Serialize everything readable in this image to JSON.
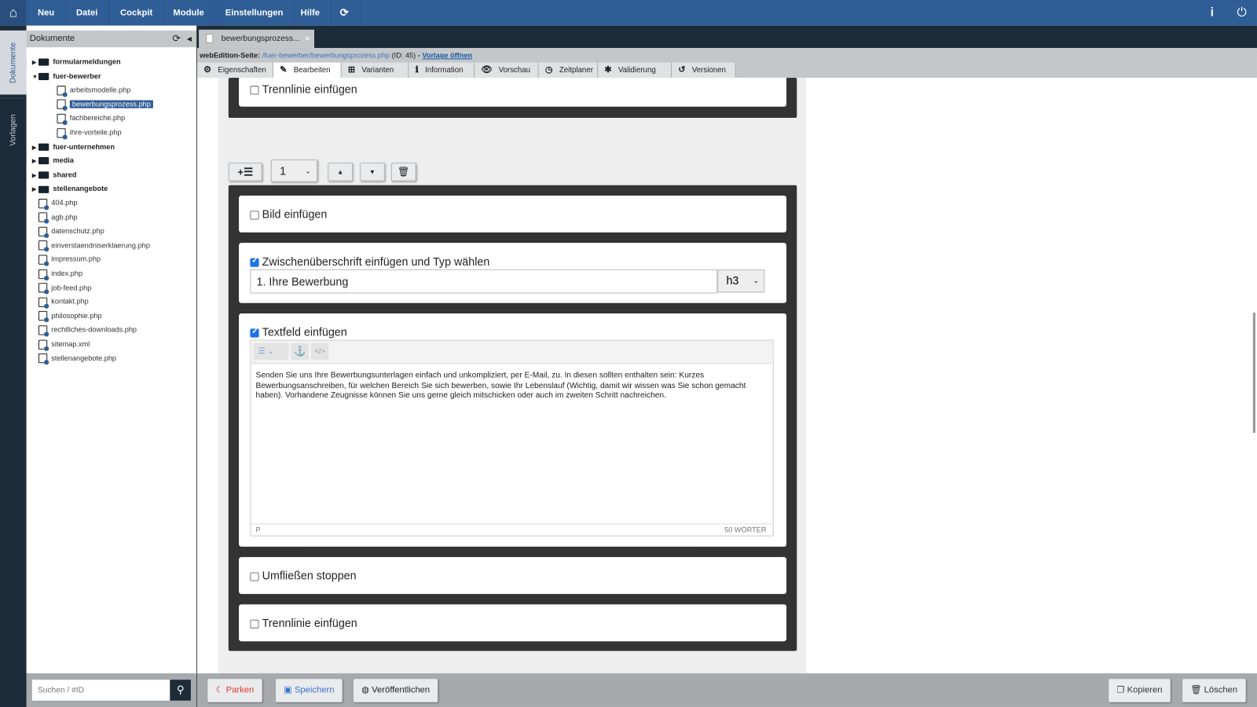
{
  "topbar": {
    "menu": [
      "Neu",
      "Datei",
      "Cockpit",
      "Module",
      "Einstellungen",
      "Hilfe"
    ],
    "icons": [
      "home-icon",
      "refresh-icon",
      "info-icon",
      "power-icon"
    ]
  },
  "vtabs": {
    "documents": "Dokumente",
    "templates": "Vorlagen"
  },
  "sidebar": {
    "title": "Dokumente",
    "tree": [
      {
        "label": "formularmeldungen",
        "type": "folder",
        "level": 0
      },
      {
        "label": "fuer-bewerber",
        "type": "folder-open",
        "level": 0
      },
      {
        "label": "arbeitsmodelle.php",
        "type": "file",
        "level": 1
      },
      {
        "label": "bewerbungsprozess.php",
        "type": "file",
        "level": 1,
        "selected": true
      },
      {
        "label": "fachbereiche.php",
        "type": "file",
        "level": 1
      },
      {
        "label": "ihre-vorteile.php",
        "type": "file",
        "level": 1
      },
      {
        "label": "fuer-unternehmen",
        "type": "folder",
        "level": 0
      },
      {
        "label": "media",
        "type": "folder",
        "level": 0
      },
      {
        "label": "shared",
        "type": "folder",
        "level": 0
      },
      {
        "label": "stellenangebote",
        "type": "folder",
        "level": 0
      },
      {
        "label": "404.php",
        "type": "file",
        "level": 0
      },
      {
        "label": "agb.php",
        "type": "file",
        "level": 0
      },
      {
        "label": "datenschutz.php",
        "type": "file",
        "level": 0
      },
      {
        "label": "einverstaendniserklaerung.php",
        "type": "file",
        "level": 0
      },
      {
        "label": "impressum.php",
        "type": "file",
        "level": 0
      },
      {
        "label": "index.php",
        "type": "file",
        "level": 0
      },
      {
        "label": "job-feed.php",
        "type": "file",
        "level": 0
      },
      {
        "label": "kontakt.php",
        "type": "file",
        "level": 0
      },
      {
        "label": "philosophie.php",
        "type": "file",
        "level": 0
      },
      {
        "label": "rechtliches-downloads.php",
        "type": "file",
        "level": 0
      },
      {
        "label": "sitemap.xml",
        "type": "file",
        "level": 0
      },
      {
        "label": "stellenangebote.php",
        "type": "file",
        "level": 0
      }
    ],
    "search_placeholder": "Suchen / #ID"
  },
  "doc_tab": {
    "label": "bewerbungsprozess...",
    "close": "×"
  },
  "pathbar": {
    "prefix": "webEdition-Seite:",
    "path": "/fuer-bewerber/bewerbungsprozess.php",
    "id": "(ID: 45)",
    "sep": "-",
    "link": "Vorlage öffnen"
  },
  "subtabs": [
    {
      "label": "Eigenschaften",
      "icon": "⚙"
    },
    {
      "label": "Bearbeiten",
      "icon": "✎",
      "active": true
    },
    {
      "label": "Varianten",
      "icon": "⊞"
    },
    {
      "label": "Information",
      "icon": "ℹ"
    },
    {
      "label": "Vorschau",
      "icon": "👁"
    },
    {
      "label": "Zeitplaner",
      "icon": "◷"
    },
    {
      "label": "Validierung",
      "icon": "✱"
    },
    {
      "label": "Versionen",
      "icon": "↺"
    }
  ],
  "editor": {
    "top_divider": "Trennlinie einfügen",
    "block_select": "1",
    "image": {
      "label": "Bild einfügen",
      "checked": false
    },
    "heading": {
      "label": "Zwischenüberschrift einfügen und Typ wählen",
      "checked": true,
      "value": "1. Ihre Bewerbung",
      "type": "h3"
    },
    "text": {
      "label": "Textfeld einfügen",
      "checked": true,
      "body": "Senden Sie uns Ihre Bewerbungsunterlagen einfach und unkompliziert, per E-Mail, zu. In diesen sollten enthalten sein: Kurzes Bewerbungsanschreiben, für welchen Bereich Sie sich bewerben, sowie Ihr Lebenslauf (Wichtig, damit wir wissen was Sie schon gemacht haben). Vorhandene Zeugnisse können Sie uns gerne gleich mitschicken oder auch im zweiten Schritt nachreichen.",
      "path": "P",
      "wordcount": "50 WÖRTER"
    },
    "float_stop": {
      "label": "Umfließen stoppen",
      "checked": false
    },
    "divider": {
      "label": "Trennlinie einfügen",
      "checked": false
    }
  },
  "bottom": {
    "park": "Parken",
    "save": "Speichern",
    "publish": "Veröffentlichen",
    "copy": "Kopieren",
    "delete": "Löschen"
  },
  "colors": {
    "brand": "#2f5e96",
    "dark": "#1b2b3a",
    "park": "#e8362f",
    "save": "#3a6fd0"
  }
}
